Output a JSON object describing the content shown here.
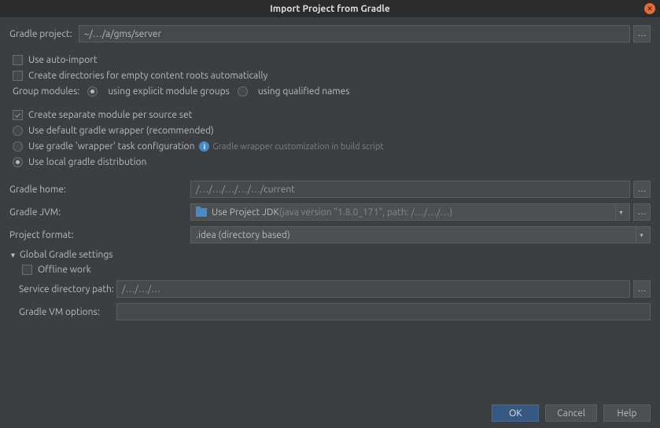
{
  "window": {
    "title": "Import Project from Gradle"
  },
  "gradleProject": {
    "label": "Gradle project:",
    "value": "~/…/a/gms/server"
  },
  "options": {
    "autoImport": "Use auto-import",
    "createDirs": "Create directories for empty content roots automatically",
    "groupModulesLabel": "Group modules:",
    "explicitGroups": "using explicit module groups",
    "qualifiedNames": "using qualified names",
    "separateModule": "Create separate module per source set",
    "defaultWrapper": "Use default gradle wrapper (recommended)",
    "wrapperTask": "Use gradle 'wrapper' task configuration",
    "wrapperHint": "Gradle wrapper customization in build script",
    "localDist": "Use local gradle distribution"
  },
  "fields": {
    "gradleHome": {
      "label": "Gradle home:",
      "value": "/…/…/…/…/…/current"
    },
    "gradleJvm": {
      "label": "Gradle JVM:",
      "prefix": "Use Project JDK",
      "suffix": " (java version \"1.8.0_171\", path: /…/…/…)"
    },
    "projectFormat": {
      "label": "Project format:",
      "value": ".idea (directory based)"
    }
  },
  "globalSection": {
    "header": "Global Gradle settings",
    "offlineWork": "Offline work",
    "serviceDirLabel": "Service directory path:",
    "serviceDirValue": "/…/…/…",
    "vmOptionsLabel": "Gradle VM options:",
    "vmOptionsValue": ""
  },
  "buttons": {
    "ok": "OK",
    "cancel": "Cancel",
    "help": "Help"
  }
}
